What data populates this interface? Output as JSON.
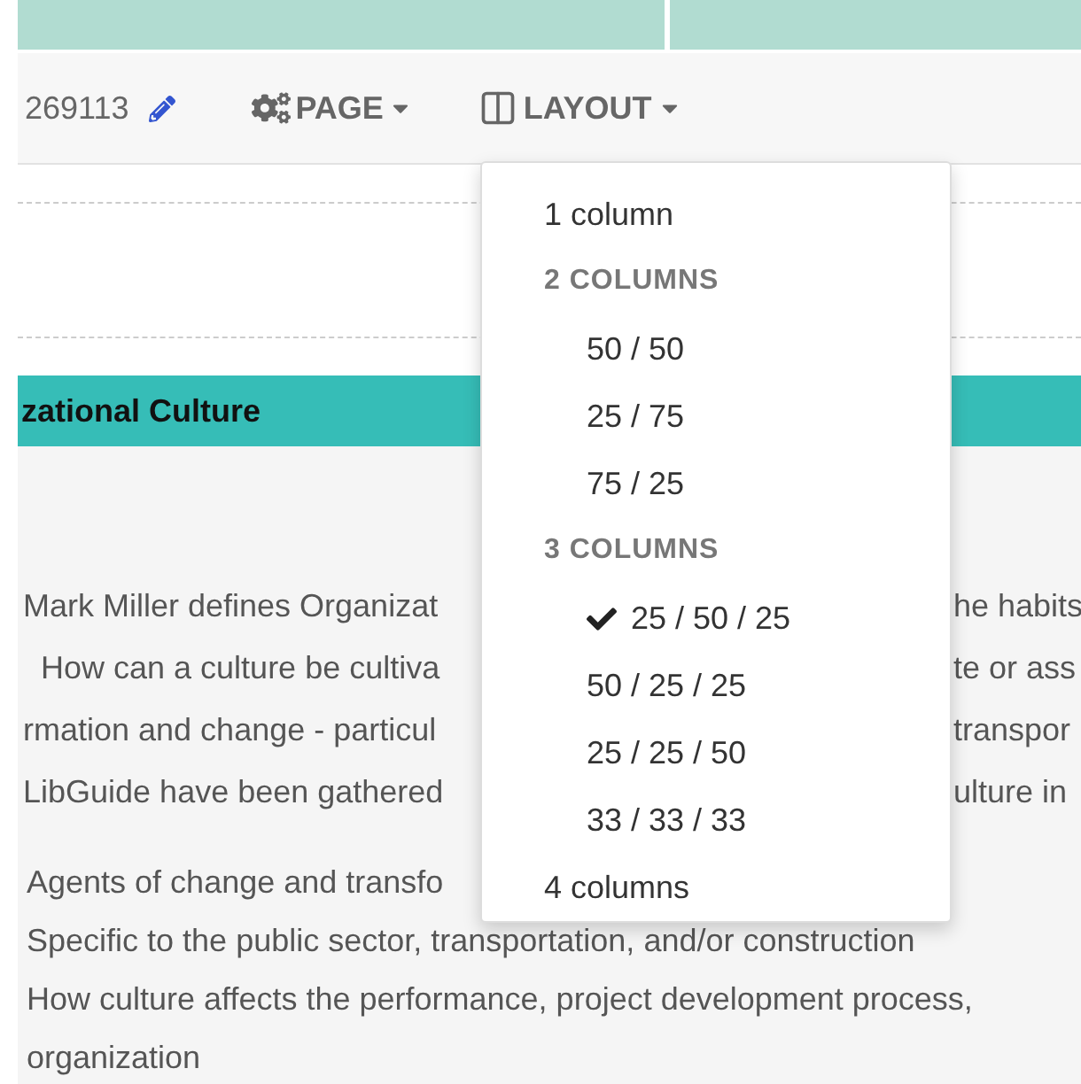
{
  "top_tabs": [
    {
      "selected": false
    },
    {
      "selected": false
    }
  ],
  "toolbar": {
    "guide_id": "269113",
    "page_menu": "PAGE",
    "layout_menu": "LAYOUT"
  },
  "section_header": "zational Culture",
  "paragraph_lines": [
    {
      "left": "Mark Miller defines Organizat",
      "right": "he habits"
    },
    {
      "left": "  How can a culture be cultiva",
      "right": "te or ass"
    },
    {
      "left": "rmation and change - particul",
      "right": "transpor"
    },
    {
      "left": "LibGuide have been gathered",
      "right": "ulture in"
    }
  ],
  "bullet_lines": [
    "Agents of change and transfo",
    "Specific to the public sector, transportation, and/or construction",
    "How culture affects the performance, project development process,",
    "organization"
  ],
  "layout_dropdown": [
    {
      "kind": "option",
      "label": "1 column",
      "selected": false
    },
    {
      "kind": "group",
      "label": "2 COLUMNS",
      "children": [
        {
          "label": "50 / 50",
          "selected": false
        },
        {
          "label": "25 / 75",
          "selected": false
        },
        {
          "label": "75 / 25",
          "selected": false
        }
      ]
    },
    {
      "kind": "group",
      "label": "3 COLUMNS",
      "children": [
        {
          "label": "25 / 50 / 25",
          "selected": true
        },
        {
          "label": "50 / 25 / 25",
          "selected": false
        },
        {
          "label": "25 / 25 / 50",
          "selected": false
        },
        {
          "label": "33 / 33 / 33",
          "selected": false
        }
      ]
    },
    {
      "kind": "option",
      "label": "4 columns",
      "selected": false
    }
  ]
}
